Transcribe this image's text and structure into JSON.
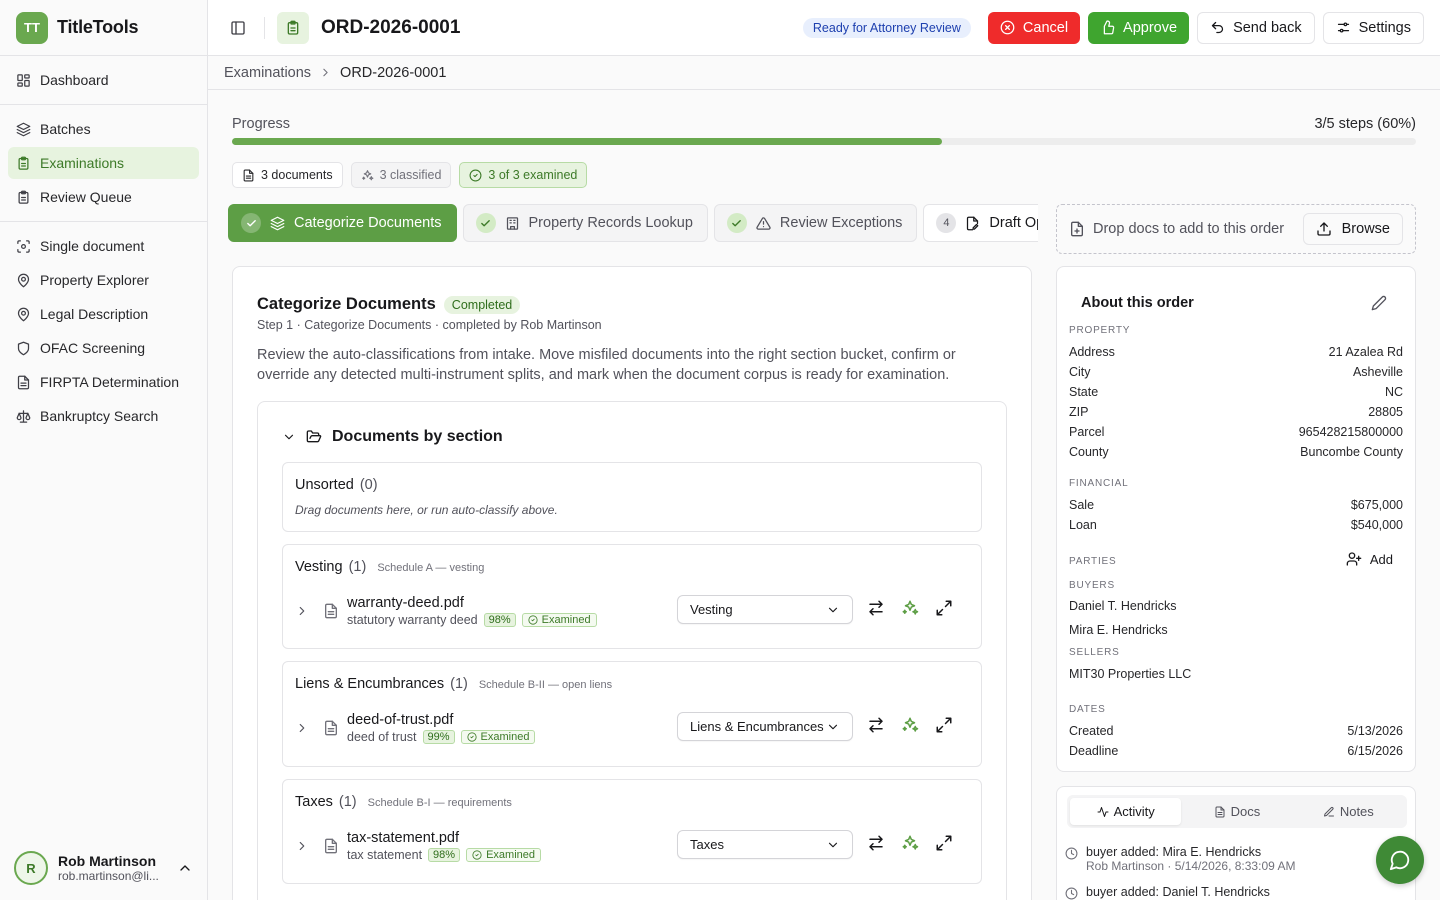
{
  "app": {
    "logo_initials": "TT",
    "name": "TitleTools"
  },
  "sidebar": {
    "groups": [
      [
        {
          "label": "Dashboard",
          "icon": "dashboard-icon"
        }
      ],
      [
        {
          "label": "Batches",
          "icon": "layers-icon"
        },
        {
          "label": "Examinations",
          "icon": "clipboard-icon",
          "active": true
        },
        {
          "label": "Review Queue",
          "icon": "clipboard-icon"
        }
      ],
      [
        {
          "label": "Single document",
          "icon": "scan-icon"
        },
        {
          "label": "Property Explorer",
          "icon": "map-pin-icon"
        },
        {
          "label": "Legal Description",
          "icon": "map-pin-icon"
        },
        {
          "label": "OFAC Screening",
          "icon": "shield-icon"
        },
        {
          "label": "FIRPTA Determination",
          "icon": "document-icon"
        },
        {
          "label": "Bankruptcy Search",
          "icon": "scale-icon"
        }
      ]
    ],
    "user": {
      "initial": "R",
      "name": "Rob Martinson",
      "email": "rob.martinson@li..."
    }
  },
  "header": {
    "order_id": "ORD-2026-0001",
    "status": "Ready for Attorney Review",
    "buttons": {
      "cancel": "Cancel",
      "approve": "Approve",
      "send_back": "Send back",
      "settings": "Settings"
    }
  },
  "breadcrumb": {
    "parent": "Examinations",
    "current": "ORD-2026-0001"
  },
  "progress": {
    "label": "Progress",
    "value_text": "3/5 steps (60%)",
    "fraction": 0.6
  },
  "chips": {
    "documents": "3 documents",
    "classified": "3 classified",
    "examined": "3 of 3 examined"
  },
  "steps": [
    {
      "label": "Categorize Documents",
      "state": "active"
    },
    {
      "label": "Property Records Lookup",
      "state": "done"
    },
    {
      "label": "Review Exceptions",
      "state": "done"
    },
    {
      "label": "Draft Opinion",
      "state": "pending",
      "number": "4"
    }
  ],
  "step_card": {
    "title": "Categorize Documents",
    "status": "Completed",
    "subtitle": "Step 1 · Categorize Documents · completed by Rob Martinson",
    "description": "Review the auto-classifications from intake. Move misfiled documents into the right section bucket, confirm or override any detected multi-instrument splits, and mark when the document corpus is ready for examination."
  },
  "docs_by_section": {
    "title": "Documents by section",
    "sections": [
      {
        "name": "Unsorted",
        "count": "(0)",
        "note": "",
        "empty_text": "Drag documents here, or run auto-classify above."
      },
      {
        "name": "Vesting",
        "count": "(1)",
        "note": "Schedule A — vesting",
        "doc": {
          "file": "warranty-deed.pdf",
          "type": "statutory warranty deed",
          "confidence": "98%",
          "status": "Examined",
          "section_select": "Vesting"
        }
      },
      {
        "name": "Liens & Encumbrances",
        "count": "(1)",
        "note": "Schedule B-II — open liens",
        "doc": {
          "file": "deed-of-trust.pdf",
          "type": "deed of trust",
          "confidence": "99%",
          "status": "Examined",
          "section_select": "Liens & Encumbrances"
        }
      },
      {
        "name": "Taxes",
        "count": "(1)",
        "note": "Schedule B-I — requirements",
        "doc": {
          "file": "tax-statement.pdf",
          "type": "tax statement",
          "confidence": "98%",
          "status": "Examined",
          "section_select": "Taxes"
        }
      }
    ]
  },
  "dropzone": {
    "text": "Drop docs to add to this order",
    "button": "Browse"
  },
  "about": {
    "title": "About this order",
    "property_label": "PROPERTY",
    "property": [
      {
        "k": "Address",
        "v": "21 Azalea Rd"
      },
      {
        "k": "City",
        "v": "Asheville"
      },
      {
        "k": "State",
        "v": "NC"
      },
      {
        "k": "ZIP",
        "v": "28805"
      },
      {
        "k": "Parcel",
        "v": "965428215800000"
      },
      {
        "k": "County",
        "v": "Buncombe County"
      }
    ],
    "financial_label": "FINANCIAL",
    "financial": [
      {
        "k": "Sale",
        "v": "$675,000"
      },
      {
        "k": "Loan",
        "v": "$540,000"
      }
    ],
    "parties_label": "PARTIES",
    "add_label": "Add",
    "buyers_label": "BUYERS",
    "buyers": [
      "Daniel T. Hendricks",
      "Mira E. Hendricks"
    ],
    "sellers_label": "SELLERS",
    "sellers": [
      "MIT30 Properties LLC"
    ],
    "dates_label": "DATES",
    "dates": [
      {
        "k": "Created",
        "v": "5/13/2026"
      },
      {
        "k": "Deadline",
        "v": "6/15/2026"
      }
    ]
  },
  "activity_panel": {
    "tabs": [
      "Activity",
      "Docs",
      "Notes"
    ],
    "items": [
      {
        "text": "buyer added: Mira E. Hendricks",
        "meta": "Rob Martinson · 5/14/2026, 8:33:09 AM"
      },
      {
        "text": "buyer added: Daniel T. Hendricks",
        "meta": ""
      }
    ]
  },
  "colors": {
    "brand": "#6aa84f",
    "danger": "#ef2b2b",
    "approve": "#3fa52f",
    "status_blue": "#1e40af"
  }
}
